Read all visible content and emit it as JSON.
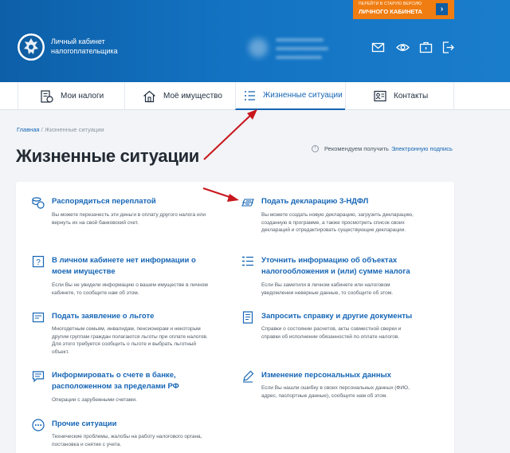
{
  "header": {
    "old_version_line1": "ПЕРЕЙТИ В СТАРУЮ ВЕРСИЮ",
    "old_version_line2": "ЛИЧНОГО КАБИНЕТА",
    "title_line1": "Личный кабинет",
    "title_line2": "налогоплательщика",
    "icons": [
      "mail-icon",
      "eye-icon",
      "briefcase-icon",
      "logout-icon"
    ]
  },
  "nav": {
    "tabs": [
      {
        "label": "Мои налоги",
        "icon": "taxes-icon"
      },
      {
        "label": "Моё имущество",
        "icon": "house-icon"
      },
      {
        "label": "Жизненные ситуации",
        "icon": "list-icon",
        "active": true
      },
      {
        "label": "Контакты",
        "icon": "contacts-icon"
      }
    ]
  },
  "breadcrumb": {
    "home": "Главная",
    "separator": " / ",
    "current": "Жизненные ситуации"
  },
  "page_title": "Жизненные ситуации",
  "recommend": {
    "text": "Рекомендуем получить",
    "link": "Электронную подпись"
  },
  "situations": [
    {
      "title": "Распорядиться переплатой",
      "desc": "Вы можете перезачесть эти деньги в оплату другого налога или вернуть их на свой банковский счет."
    },
    {
      "title": "Подать декларацию 3-НДФЛ",
      "desc": "Вы можете создать новую декларацию, загрузить декларацию, созданную в программе, а также просмотреть список своих деклараций и отредактировать существующие декларации."
    },
    {
      "title": "В личном кабинете нет информации о моем имуществе",
      "desc": "Если Вы не увидели информацию о вашем имуществе в личном кабинете, то сообщите нам об этом."
    },
    {
      "title": "Уточнить информацию об объектах налогообложения и (или) сумме налога",
      "desc": "Если Вы заметили в личном кабинете или налоговом уведомлении неверные данные, то сообщите об этом."
    },
    {
      "title": "Подать заявление о льготе",
      "desc": "Многодетным семьям, инвалидам, пенсионерам и некоторым другим группам граждан полагаются льготы при оплате налогов. Для этого требуется сообщить о льготе и выбрать льготный объект."
    },
    {
      "title": "Запросить справку и другие документы",
      "desc": "Справки о состоянии расчетов, акты совместной сверки и справки об исполнении обязанностей по оплате налогов."
    },
    {
      "title": "Информировать о счете в банке, расположенном за пределами РФ",
      "desc": "Операции с зарубежными счетами."
    },
    {
      "title": "Изменение персональных данных",
      "desc": "Если Вы нашли ошибку в своих персональных данных (ФИО, адрес, паспортные данные), сообщите нам об этом."
    },
    {
      "title": "Прочие ситуации",
      "desc": "Технические проблемы, жалобы на работу налогового органа, постановка и снятие с учета."
    }
  ],
  "colors": {
    "header": "#1373c2",
    "link": "#1565b5",
    "orange": "#f07d12",
    "annotation_arrow": "#c8161d"
  }
}
